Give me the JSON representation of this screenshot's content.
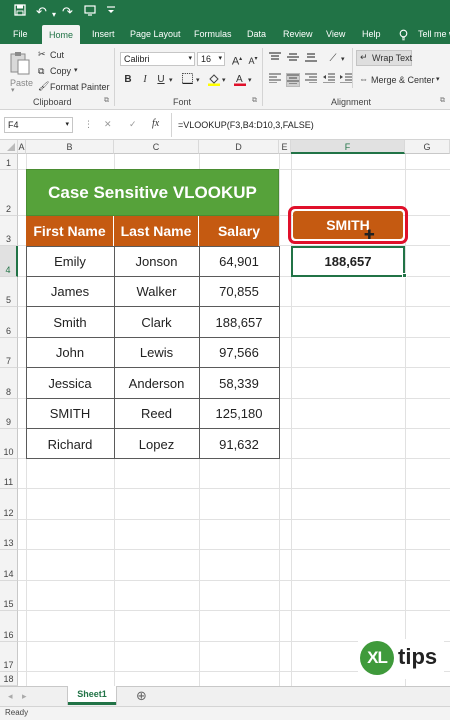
{
  "ribbon_tabs": [
    "File",
    "Home",
    "Insert",
    "Page Layout",
    "Formulas",
    "Data",
    "Review",
    "View",
    "Help"
  ],
  "tell_me": "Tell me w",
  "clipboard": {
    "paste": "Paste",
    "cut": "Cut",
    "copy": "Copy",
    "format_painter": "Format Painter",
    "label": "Clipboard"
  },
  "font": {
    "name": "Calibri",
    "size": "16",
    "label": "Font"
  },
  "alignment": {
    "wrap_text": "Wrap Text",
    "merge_center": "Merge & Center",
    "label": "Alignment"
  },
  "formula_bar": {
    "name_box": "F4",
    "cancel": "✕",
    "enter": "✓",
    "fx": "fx",
    "formula": "=VLOOKUP(F3,B4:D10,3,FALSE)"
  },
  "columns": [
    "A",
    "B",
    "C",
    "D",
    "E",
    "F",
    "G"
  ],
  "rows": [
    "1",
    "2",
    "3",
    "4",
    "5",
    "6",
    "7",
    "8",
    "9",
    "10",
    "11",
    "12",
    "13",
    "14",
    "15",
    "16",
    "17",
    "18"
  ],
  "sheet": {
    "title": "Case Sensitive VLOOKUP",
    "headers": [
      "First Name",
      "Last Name",
      "Salary"
    ],
    "data": [
      [
        "Emily",
        "Jonson",
        "64,901"
      ],
      [
        "James",
        "Walker",
        "70,855"
      ],
      [
        "Smith",
        "Clark",
        "188,657"
      ],
      [
        "John",
        "Lewis",
        "97,566"
      ],
      [
        "Jessica",
        "Anderson",
        "58,339"
      ],
      [
        "SMITH",
        "Reed",
        "125,180"
      ],
      [
        "Richard",
        "Lopez",
        "91,632"
      ]
    ],
    "lookup_value": "SMITH",
    "result": "188,657"
  },
  "sheet_tabs": {
    "active": "Sheet1",
    "add": "⊕"
  },
  "status": "Ready",
  "logo": {
    "xl": "XL",
    "tips": "tips"
  },
  "colors": {
    "excel_green": "#217346",
    "title_green": "#56a23a",
    "header_orange": "#c55a11",
    "lookup_border": "#e0102a"
  }
}
